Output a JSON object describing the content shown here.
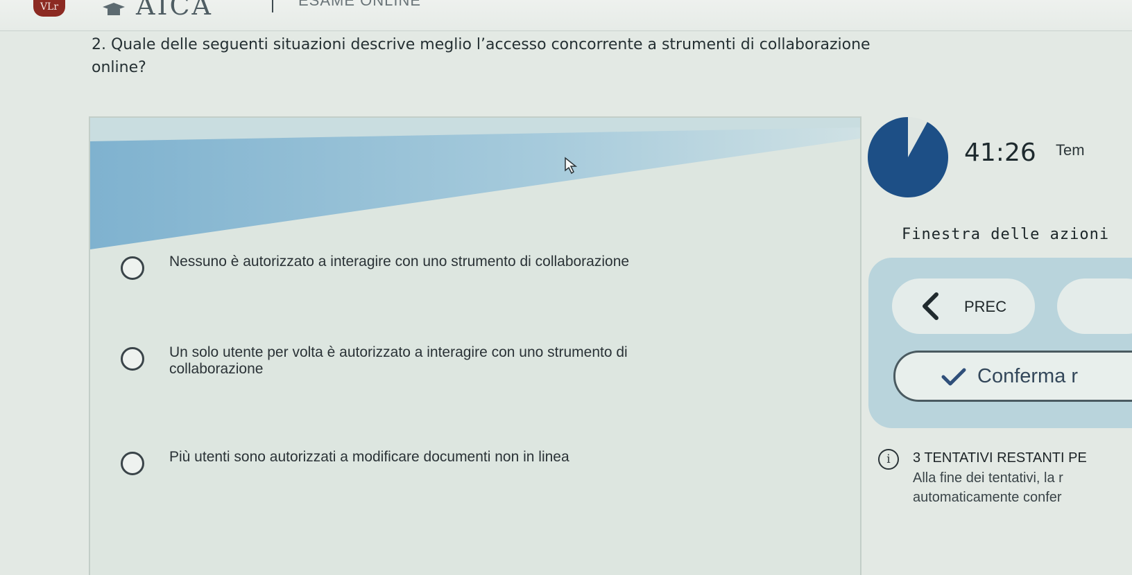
{
  "header": {
    "logo_badge_text": "VLr",
    "brand": "AICA",
    "exam_label": "ESAME ONLINE"
  },
  "question": {
    "text": "2. Quale delle seguenti situazioni descrive meglio l’accesso concorrente a strumenti di collaborazione online?"
  },
  "options": [
    {
      "text": "Nessuno è autorizzato a interagire con uno strumento di collaborazione",
      "selected": false
    },
    {
      "text": "Un solo utente per volta è autorizzato a interagire con uno strumento di collaborazione",
      "selected": false
    },
    {
      "text": "Più utenti sono autorizzati a modificare documenti non in linea",
      "selected": false
    }
  ],
  "timer": {
    "value": "41:26",
    "label": "Tem",
    "remaining_fraction": 0.92,
    "color": "#1d4f86"
  },
  "actions": {
    "title": "Finestra delle azioni",
    "prev_label": "PREC",
    "confirm_label": "Conferma r"
  },
  "attempts": {
    "title": "3 TENTATIVI RESTANTI PE",
    "note": "Alla fine dei tentativi, la r automaticamente confer"
  },
  "colors": {
    "accent_blue": "#1d4f86",
    "brand_red": "#8c2a22",
    "action_panel": "#b9d4dc"
  }
}
